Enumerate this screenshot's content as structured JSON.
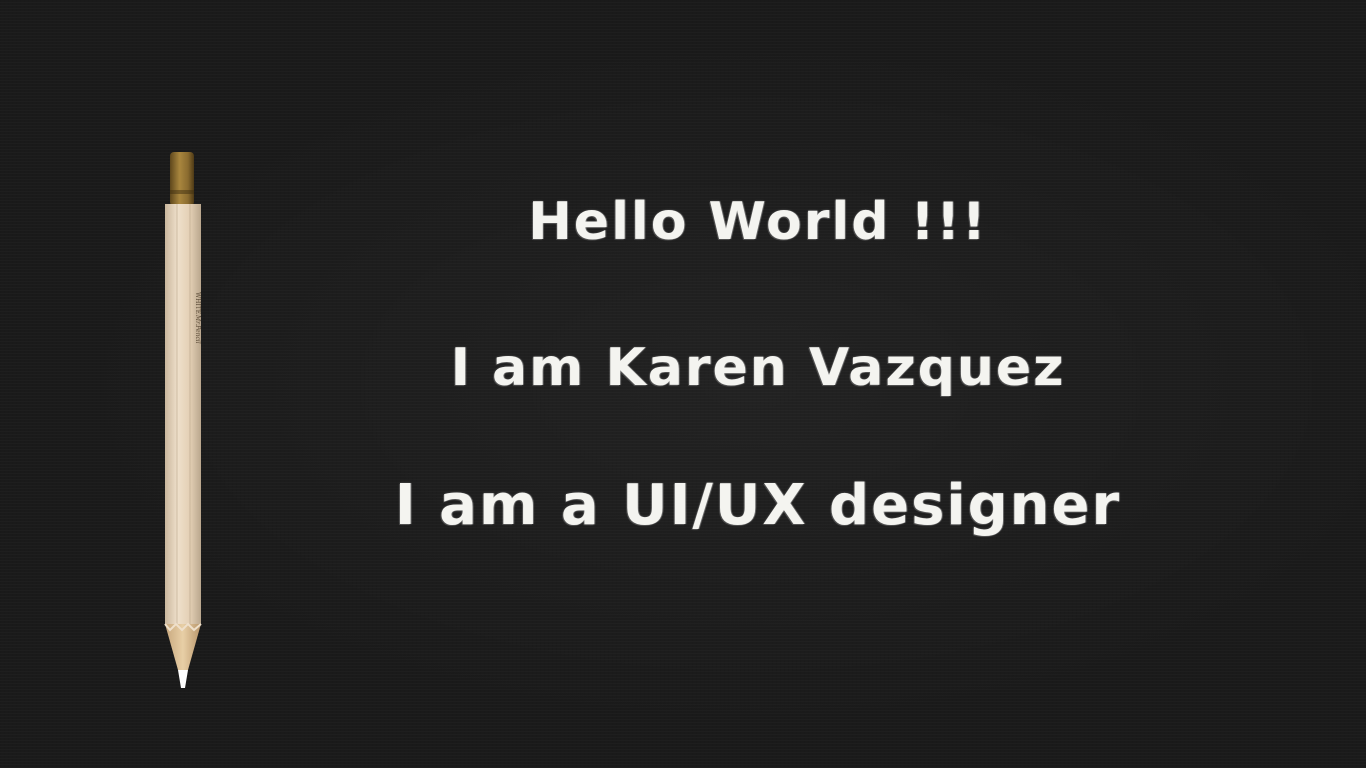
{
  "hero": {
    "greeting": "Hello World !!!",
    "intro": "I am Karen Vazquez",
    "role": "I am a UI/UX designer"
  },
  "pencil": {
    "icon": "pencil-icon",
    "brand_text": "Mr.Pencil",
    "color_label": "WHITE",
    "grade": "2"
  },
  "colors": {
    "background": "#1a1a1a",
    "text": "#f4f4f0",
    "pencil_body": "#e6d2b8",
    "pencil_ferrule": "#8a6b2f",
    "pencil_core": "#ffffff"
  }
}
